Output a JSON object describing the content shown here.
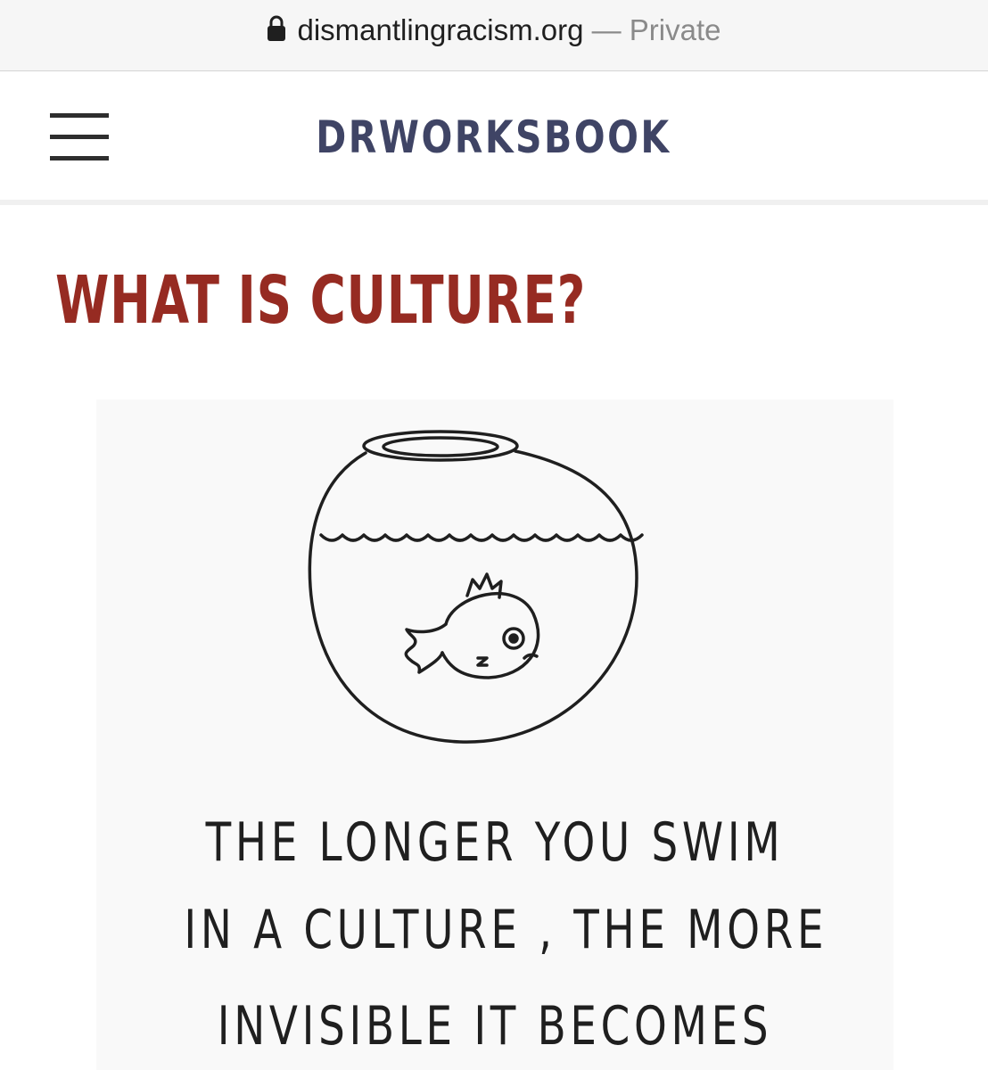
{
  "browser": {
    "domain": "dismantlingracism.org",
    "separator": "—",
    "mode": "Private"
  },
  "header": {
    "site_title": "DRWORKSBOOK",
    "title_color": "#3f4465"
  },
  "main": {
    "heading": "WHAT IS CULTURE?",
    "heading_color": "#962b22",
    "illustration": {
      "icon": "fishbowl-illustration",
      "caption_lines": [
        "THE LONGER YOU SWIM",
        "IN A CULTURE , THE MORE",
        "INVISIBLE IT BECOMES"
      ]
    }
  }
}
